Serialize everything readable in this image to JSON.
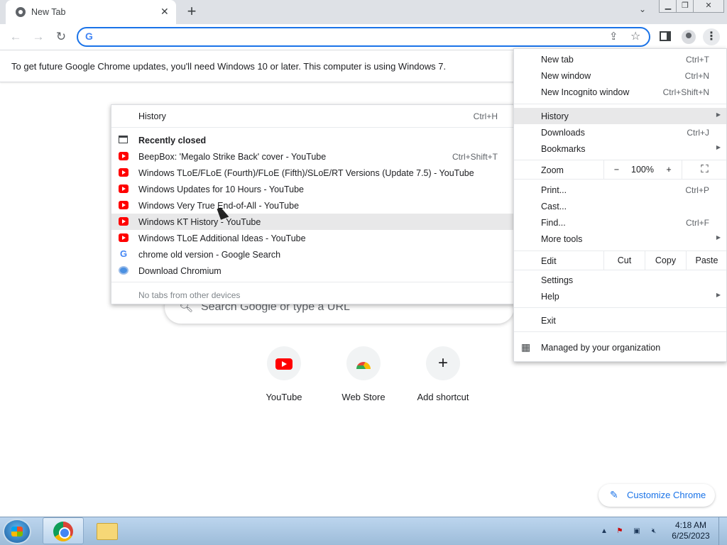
{
  "tab": {
    "title": "New Tab"
  },
  "omnibox": {
    "value": "",
    "placeholder": ""
  },
  "infobar": {
    "text": "To get future Google Chrome updates, you'll need Windows 10 or later. This computer is using Windows 7."
  },
  "ntp": {
    "search_placeholder": "Search Google or type a URL",
    "shortcuts": [
      {
        "label": "YouTube",
        "icon": "youtube-icon"
      },
      {
        "label": "Web Store",
        "icon": "web-store-icon"
      },
      {
        "label": "Add shortcut",
        "icon": "plus-icon"
      }
    ],
    "customize_label": "Customize Chrome"
  },
  "main_menu": {
    "new_tab": {
      "label": "New tab",
      "shortcut": "Ctrl+T"
    },
    "new_window": {
      "label": "New window",
      "shortcut": "Ctrl+N"
    },
    "new_incognito": {
      "label": "New Incognito window",
      "shortcut": "Ctrl+Shift+N"
    },
    "history": {
      "label": "History"
    },
    "downloads": {
      "label": "Downloads",
      "shortcut": "Ctrl+J"
    },
    "bookmarks": {
      "label": "Bookmarks"
    },
    "zoom": {
      "label": "Zoom",
      "minus": "−",
      "value": "100%",
      "plus": "+"
    },
    "print": {
      "label": "Print...",
      "shortcut": "Ctrl+P"
    },
    "cast": {
      "label": "Cast..."
    },
    "find": {
      "label": "Find...",
      "shortcut": "Ctrl+F"
    },
    "more_tools": {
      "label": "More tools"
    },
    "edit": {
      "label": "Edit",
      "cut": "Cut",
      "copy": "Copy",
      "paste": "Paste"
    },
    "settings": {
      "label": "Settings"
    },
    "help": {
      "label": "Help"
    },
    "exit": {
      "label": "Exit"
    },
    "managed": {
      "label": "Managed by your organization"
    }
  },
  "history_menu": {
    "history": {
      "label": "History",
      "shortcut": "Ctrl+H"
    },
    "recently_closed": "Recently closed",
    "items": [
      {
        "label": "BeepBox: 'Megalo Strike Back' cover - YouTube",
        "shortcut": "Ctrl+Shift+T",
        "icon": "youtube-icon"
      },
      {
        "label": "Windows TLoE/FLoE (Fourth)/FLoE (Fifth)/SLoE/RT Versions (Update 7.5) - YouTube",
        "shortcut": "",
        "icon": "youtube-icon"
      },
      {
        "label": "Windows Updates for 10 Hours - YouTube",
        "shortcut": "",
        "icon": "youtube-icon"
      },
      {
        "label": "Windows Very True End-of-All - YouTube",
        "shortcut": "",
        "icon": "youtube-icon"
      },
      {
        "label": "Windows KT History - YouTube",
        "shortcut": "",
        "icon": "youtube-icon"
      },
      {
        "label": "Windows TLoE Additional Ideas - YouTube",
        "shortcut": "",
        "icon": "youtube-icon"
      },
      {
        "label": "chrome old version - Google Search",
        "shortcut": "",
        "icon": "google-icon"
      },
      {
        "label": "Download Chromium",
        "shortcut": "",
        "icon": "chromium-icon"
      }
    ],
    "no_tabs": "No tabs from other devices"
  },
  "taskbar": {
    "time": "4:18 AM",
    "date": "6/25/2023"
  }
}
